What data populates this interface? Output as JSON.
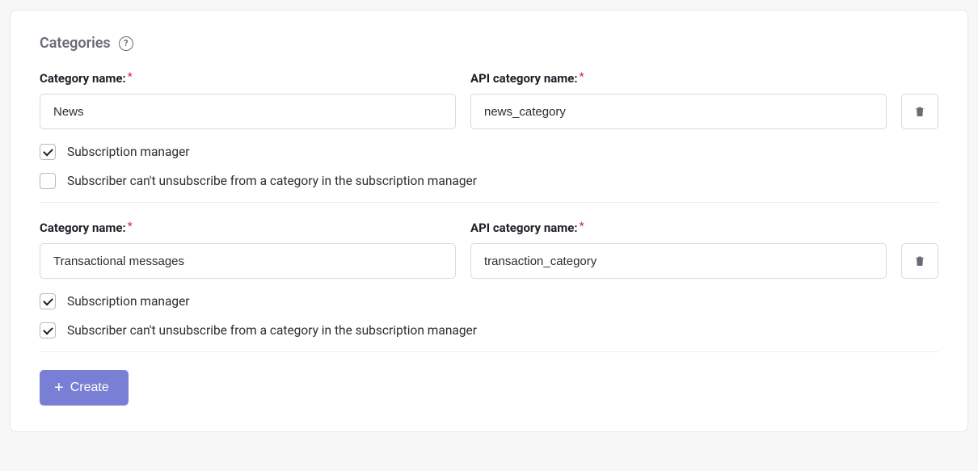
{
  "panel": {
    "title": "Categories"
  },
  "labels": {
    "category_name": "Category name:",
    "api_category_name": "API category name:",
    "subscription_manager": "Subscription manager",
    "cant_unsubscribe": "Subscriber can't unsubscribe from a category in the subscription manager"
  },
  "categories": [
    {
      "name": "News",
      "api_name": "news_category",
      "subscription_manager": true,
      "cant_unsubscribe": false
    },
    {
      "name": "Transactional messages",
      "api_name": "transaction_category",
      "subscription_manager": true,
      "cant_unsubscribe": true
    }
  ],
  "actions": {
    "create": "Create"
  }
}
